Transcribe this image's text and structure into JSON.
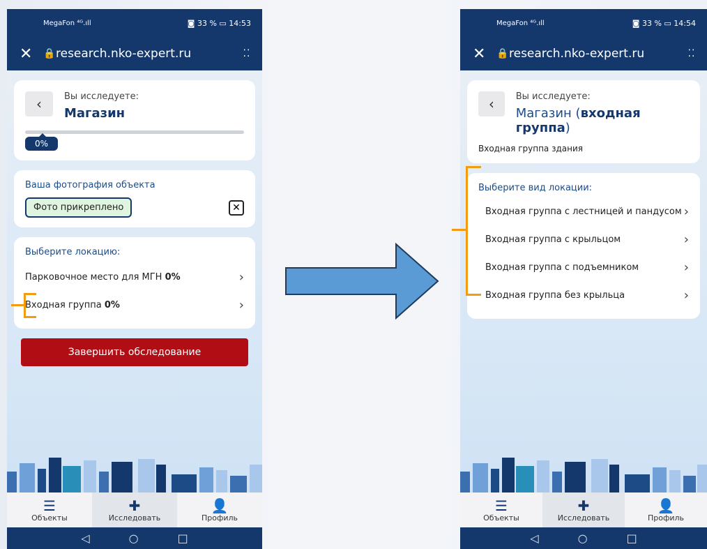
{
  "screen1": {
    "status": {
      "carrier": "MegaFon ⁴ᴳ.ıll",
      "battery": "◙ 33 % ▭ 14:53"
    },
    "browser": {
      "url": "research.nko-expert.ru"
    },
    "header": {
      "label": "Вы исследуете:",
      "object_name": "Магазин",
      "progress": "0%"
    },
    "photo": {
      "label": "Ваша фотография объекта",
      "status": "Фото прикреплено"
    },
    "locations": {
      "label": "Выберите локацию:",
      "items": [
        {
          "name": "Парковочное место для МГН",
          "pct": "0%"
        },
        {
          "name": "Входная группа",
          "pct": "0%"
        }
      ]
    },
    "finish_label": "Завершить обследование"
  },
  "screen2": {
    "status": {
      "carrier": "MegaFon ⁴ᴳ.ıll",
      "battery": "◙ 33 % ▭ 14:54"
    },
    "browser": {
      "url": "research.nko-expert.ru"
    },
    "header": {
      "label": "Вы исследуете:",
      "object_prefix": "Магазин (",
      "object_bold": "входная группа",
      "object_suffix": ")",
      "subtitle": "Входная группа здания"
    },
    "types": {
      "label": "Выберите вид локации:",
      "items": [
        "Входная группа с лестницей и пандусом",
        "Входная группа с крыльцом",
        "Входная группа с подъемником",
        "Входная группа без крыльца"
      ]
    }
  },
  "tabs": {
    "objects": "Объекты",
    "explore": "Исследовать",
    "profile": "Профиль"
  },
  "colors": {
    "primary": "#14386b",
    "accent": "#f39c12",
    "danger": "#b10d14",
    "arrow": "#5b9bd5"
  }
}
